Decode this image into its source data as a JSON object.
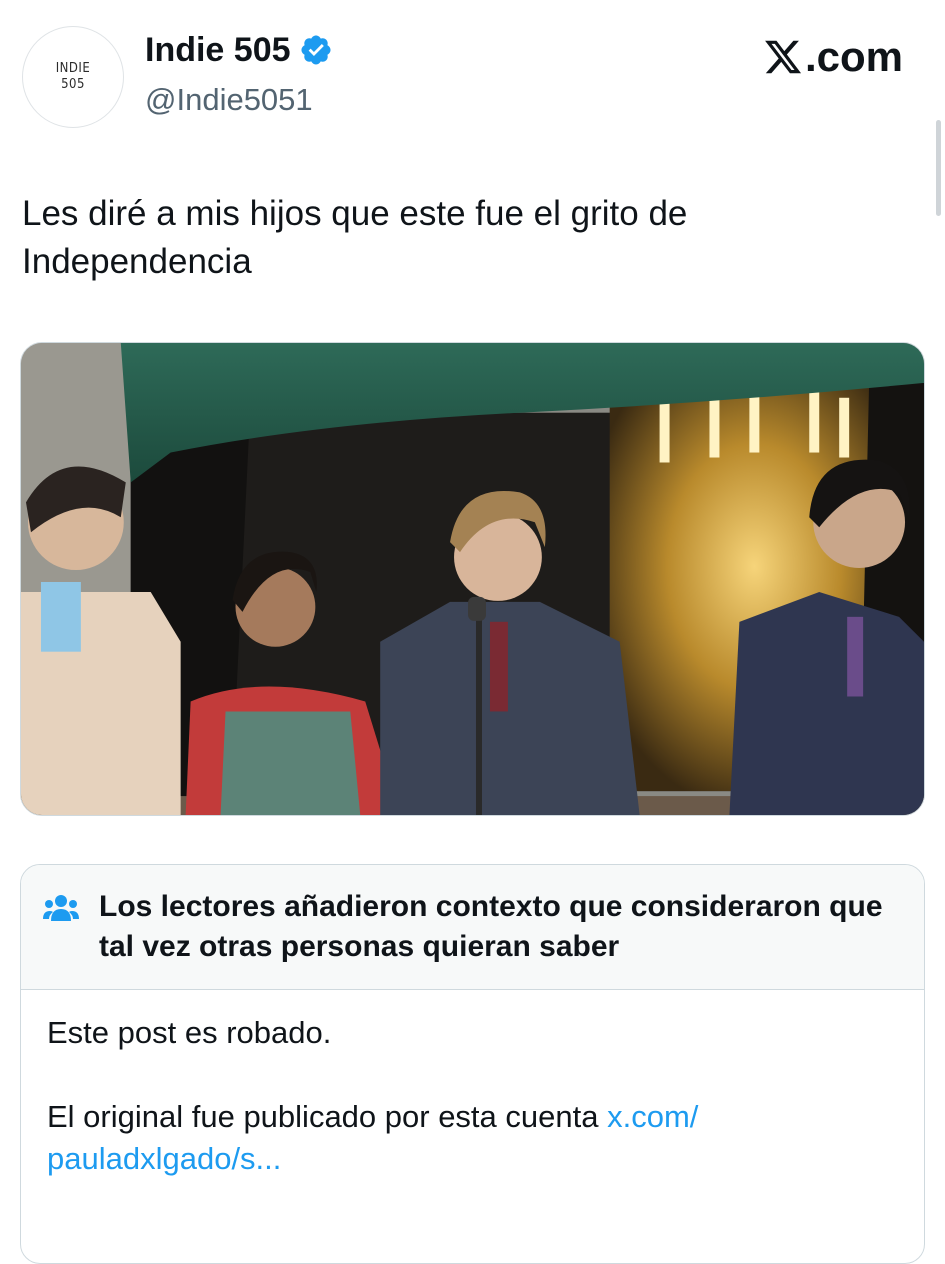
{
  "author": {
    "avatar_line1": "INDIE",
    "avatar_line2": "505",
    "display_name": "Indie 505",
    "handle": "@Indie5051",
    "verified": true
  },
  "brand": {
    "text": ".com",
    "icon": "x-logo-icon"
  },
  "post": {
    "text": "Les diré a mis hijos que este fue el grito de Independencia"
  },
  "media": {
    "icon": "photo-balcony"
  },
  "community_note": {
    "icon": "people-icon",
    "title": "Los lectores añadieron contexto que consideraron que tal vez otras personas quieran saber",
    "body_line1": "Este post es robado.",
    "body_line2_prefix": "El original fue publicado por esta cuenta ",
    "link_text": "x.com/ pauladxlgado/s..."
  },
  "colors": {
    "accent": "#1d9bf0",
    "text": "#0f1419",
    "muted": "#536471"
  }
}
